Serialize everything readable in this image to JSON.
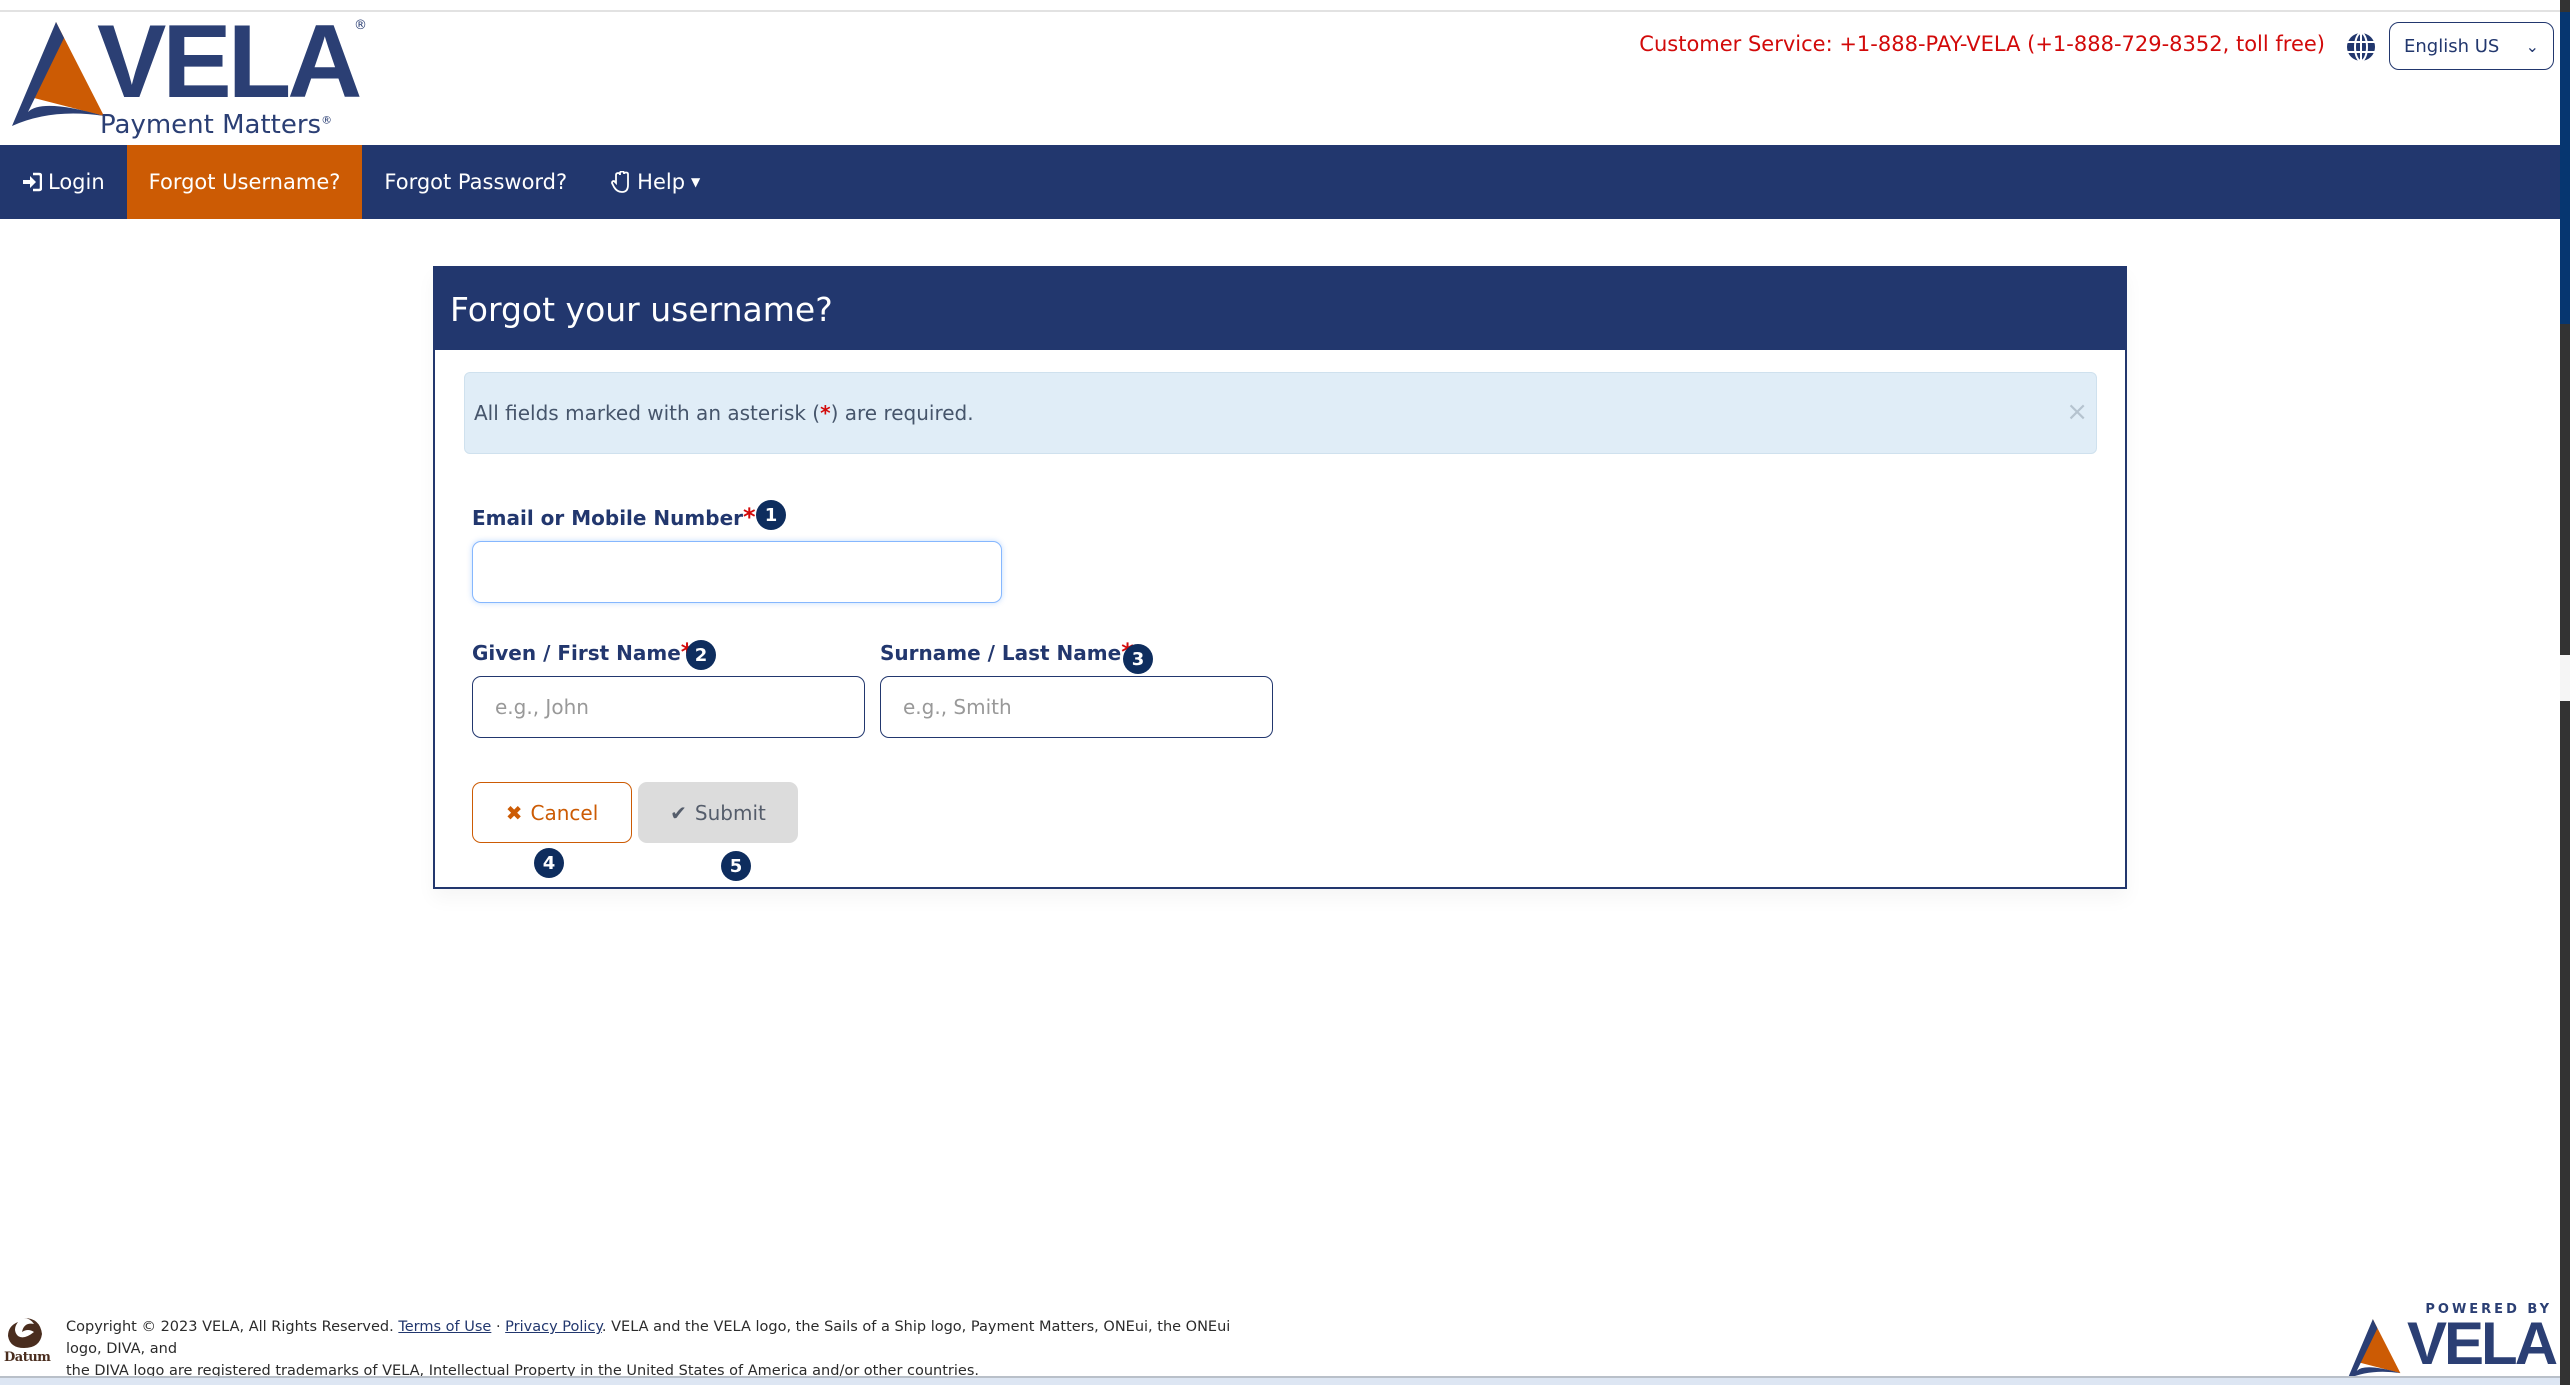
{
  "header": {
    "logo": {
      "brand": "VELA",
      "tagline": "Payment Matters",
      "registered": "®"
    },
    "customer_service": "Customer Service: +1-888-PAY-VELA (+1-888-729-8352, toll free)",
    "language": {
      "selected": "English US",
      "icon": "globe-icon"
    }
  },
  "nav": {
    "items": [
      {
        "label": "Login",
        "icon": "sign-in-icon",
        "active": false
      },
      {
        "label": "Forgot Username?",
        "active": true
      },
      {
        "label": "Forgot Password?",
        "active": false
      },
      {
        "label": "Help",
        "icon": "hand-icon",
        "dropdown": true,
        "active": false
      }
    ]
  },
  "card": {
    "title": "Forgot your username?",
    "alert": {
      "text_before": "All fields marked with an asterisk (",
      "asterisk": "*",
      "text_after": ") are required.",
      "close": "×"
    },
    "fields": {
      "email": {
        "label": "Email or Mobile Number",
        "required": "*",
        "value": "",
        "placeholder": "",
        "badge": "1"
      },
      "first_name": {
        "label": "Given / First Name",
        "required": "*",
        "value": "",
        "placeholder": "e.g., John",
        "badge": "2"
      },
      "last_name": {
        "label": "Surname / Last Name",
        "required": "*",
        "value": "",
        "placeholder": "e.g., Smith",
        "badge": "3"
      }
    },
    "buttons": {
      "cancel": {
        "label": "Cancel",
        "icon": "✖",
        "badge": "4"
      },
      "submit": {
        "label": "Submit",
        "icon": "✔",
        "badge": "5"
      }
    }
  },
  "footer": {
    "partner_logo": "Datum",
    "copyright": "Copyright © 2023 VELA, All Rights Reserved.",
    "terms_link": "Terms of Use",
    "separator": "·",
    "privacy_link": "Privacy Policy",
    "trademark_line1": ". VELA and the VELA logo, the Sails of a Ship logo, Payment Matters, ONEui, the ONEui logo, DIVA, and",
    "trademark_line2": "the DIVA logo are registered trademarks of VELA, Intellectual Property in the United States of America and/or other countries.",
    "powered_by": "POWERED BY",
    "powered_brand": "VELA"
  },
  "colors": {
    "primary": "#22376e",
    "accent": "#cc5b04",
    "required": "#d20a0a",
    "alert_bg": "#e0edf7",
    "badge": "#0e2d5e"
  }
}
